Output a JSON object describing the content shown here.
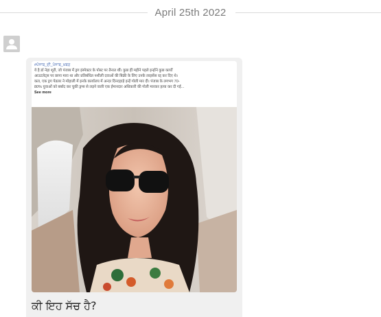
{
  "conversation": {
    "date_label": "April 25th 2022"
  },
  "message": {
    "sender_avatar_icon": "user-avatar-icon",
    "post": {
      "hashtags": "#ਪੰਜਾਬ_ਦੀ_ਪੰਜਾਬ_ਖ਼ਬਰ",
      "lines": [
        "ये है डॉ नेहा शूरी, जो पंजाब में ड्रग इंस्पेक्टर के पोस्ट पर तैनात थीं। कुछ हीं महीने पहले इन्होंने कुछ कार्यों",
        "आउटलेट्स पर छापा मारा था और प्रतिबंधित नशीली दवाओं की बिक्री के लिए उनके लाइसेंस रद्द कर दिए थे।",
        "कल, एक ड्रग पेडलर ने मोहाली में इनके कार्यालय में अन्दर दिनदहाड़े इन्हें गोली मार दी। पंजाब के लगभग 70-",
        "80% युवाओं को बर्बाद कर चुकी ड्रग्स से लड़ने वाली एक ईमानदार अधिकारी की गोली मारकर हत्या कर दी गई..."
      ],
      "see_more": "See more"
    },
    "caption": "ਕੀ ਇਹ ਸੱਚ ਹੈ?"
  }
}
